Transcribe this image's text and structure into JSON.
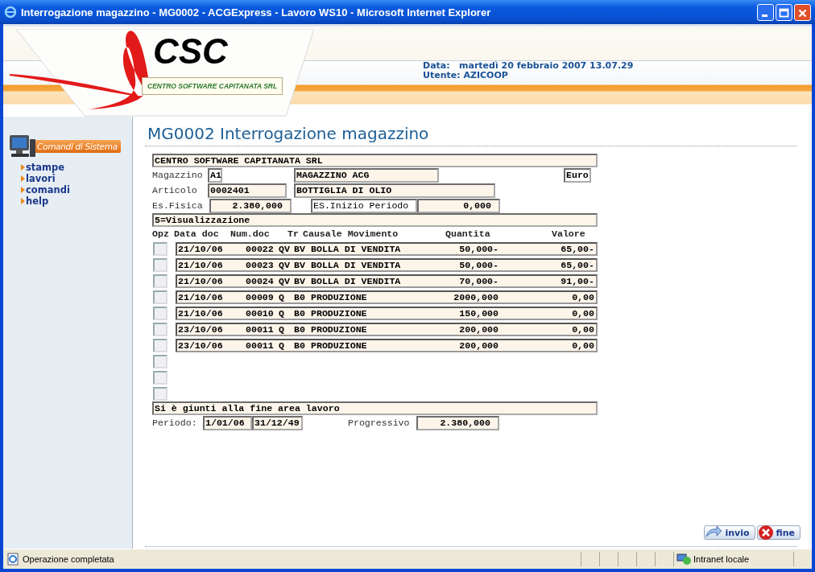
{
  "window": {
    "title": "Interrogazione magazzino - MG0002 - ACGExpress - Lavoro WS10 - Microsoft Internet Explorer"
  },
  "header": {
    "logo_name": "CSC",
    "logo_subtitle": "CENTRO SOFTWARE CAPITANATA SRL",
    "date_label": "Data:",
    "date": "martedì 20 febbraio 2007 13.07.29",
    "user": "Utente: AZICOOP"
  },
  "sidebar": {
    "title": "Comandi di Sistema",
    "items": [
      {
        "label": "stampe"
      },
      {
        "label": "lavori"
      },
      {
        "label": "comandi"
      },
      {
        "label": "help"
      }
    ]
  },
  "page": {
    "title": "MG0002 Interrogazione magazzino"
  },
  "form": {
    "company": "CENTRO SOFTWARE CAPITANATA SRL",
    "warehouse_label": "Magazzino",
    "warehouse_code": "A1",
    "warehouse_name": "MAGAZZINO ACG",
    "currency": "Euro",
    "item_label": "Articolo",
    "item_code": "0002401",
    "item_name": "BOTTIGLIA DI OLIO",
    "stock_label": "Es.Fisica",
    "stock": "2.380,000",
    "opening_label": "ES.Inizio Periodo",
    "opening": "0,000",
    "option_hint": "5=Visualizzazione"
  },
  "table": {
    "columns": [
      "Opz",
      "Data doc",
      "Num.doc",
      "Tr",
      "Causale Movimento",
      "Quantita",
      "Valore"
    ],
    "rows": [
      {
        "kind": "entry",
        "cells": [
          "21/10/06",
          "00022",
          "QV",
          "BV",
          "BOLLA DI VENDITA",
          "50,000-",
          "65,00-"
        ]
      },
      {
        "kind": "entry",
        "cells": [
          "21/10/06",
          "00023",
          "QV",
          "BV",
          "BOLLA DI VENDITA",
          "50,000-",
          "65,00-"
        ]
      },
      {
        "kind": "entry",
        "cells": [
          "21/10/06",
          "00024",
          "QV",
          "BV",
          "BOLLA DI VENDITA",
          "70,000-",
          "91,00-"
        ]
      },
      {
        "kind": "entry",
        "cells": [
          "21/10/06",
          "00009",
          "Q",
          "B0",
          "PRODUZIONE",
          "2000,000",
          "0,00"
        ]
      },
      {
        "kind": "entry",
        "cells": [
          "21/10/06",
          "00010",
          "Q",
          "B0",
          "PRODUZIONE",
          "150,000",
          "0,00"
        ]
      },
      {
        "kind": "entry",
        "cells": [
          "23/10/06",
          "00011",
          "Q",
          "B0",
          "PRODUZIONE",
          "200,000",
          "0,00"
        ]
      },
      {
        "kind": "entry",
        "cells": [
          "23/10/06",
          "00011",
          "Q",
          "B0",
          "PRODUZIONE",
          "200,000",
          "0,00"
        ]
      },
      {
        "kind": "blank"
      },
      {
        "kind": "blank"
      },
      {
        "kind": "blank"
      }
    ]
  },
  "footer_form": {
    "message": "Si è giunti alla fine area lavoro",
    "period_label": "Periodo:",
    "period_from": "1/01/06",
    "period_to": "31/12/49",
    "progressive_label": "Progressivo",
    "progressive": "2.380,000"
  },
  "buttons": [
    {
      "kind": "send",
      "label": "invio"
    },
    {
      "kind": "exit",
      "label": "fine"
    }
  ],
  "status_bar": {
    "text": "Operazione completata",
    "zone": "Intranet locale"
  }
}
